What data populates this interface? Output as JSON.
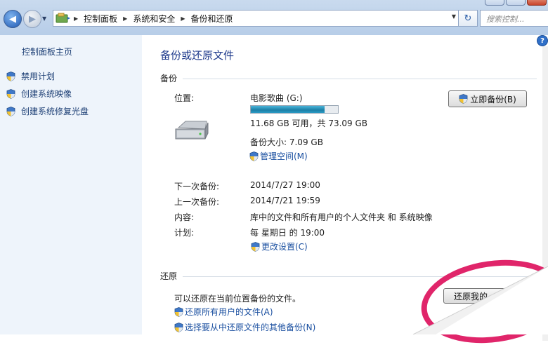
{
  "address_bar": {
    "crumbs": [
      "控制面板",
      "系统和安全",
      "备份和还原"
    ],
    "search_placeholder": "搜索控制..."
  },
  "sidebar": {
    "home": "控制面板主页",
    "items": [
      "禁用计划",
      "创建系统映像",
      "创建系统修复光盘"
    ]
  },
  "main": {
    "title": "备份或还原文件",
    "backup_section": "备份",
    "location_label": "位置:",
    "drive_name": "电影歌曲 (G:)",
    "drive_usage_fraction": 0.85,
    "drive_space": "11.68 GB 可用，共 73.09 GB",
    "backup_size": "备份大小: 7.09 GB",
    "manage_space_link": "管理空间(M)",
    "backup_now_button": "立即备份(B)",
    "next_backup_label": "下一次备份:",
    "next_backup_value": "2014/7/27 19:00",
    "last_backup_label": "上一次备份:",
    "last_backup_value": "2014/7/21 19:59",
    "contents_label": "内容:",
    "contents_value": "库中的文件和所有用户的个人文件夹 和 系统映像",
    "schedule_label": "计划:",
    "schedule_value": "每 星期日 的 19:00",
    "change_settings_link": "更改设置(C)",
    "restore_section": "还原",
    "restore_text": "可以还原在当前位置备份的文件。",
    "restore_all_users_link": "还原所有用户的文件(A)",
    "select_other_backup_link": "选择要从中还原文件的其他备份(N)",
    "restore_my_files_button": "还原我的"
  },
  "colors": {
    "accent_link": "#1a4fa0",
    "title": "#1e3a8c",
    "annotation_circle": "#e0256a",
    "sidebar_bg": "#eef4fb"
  }
}
